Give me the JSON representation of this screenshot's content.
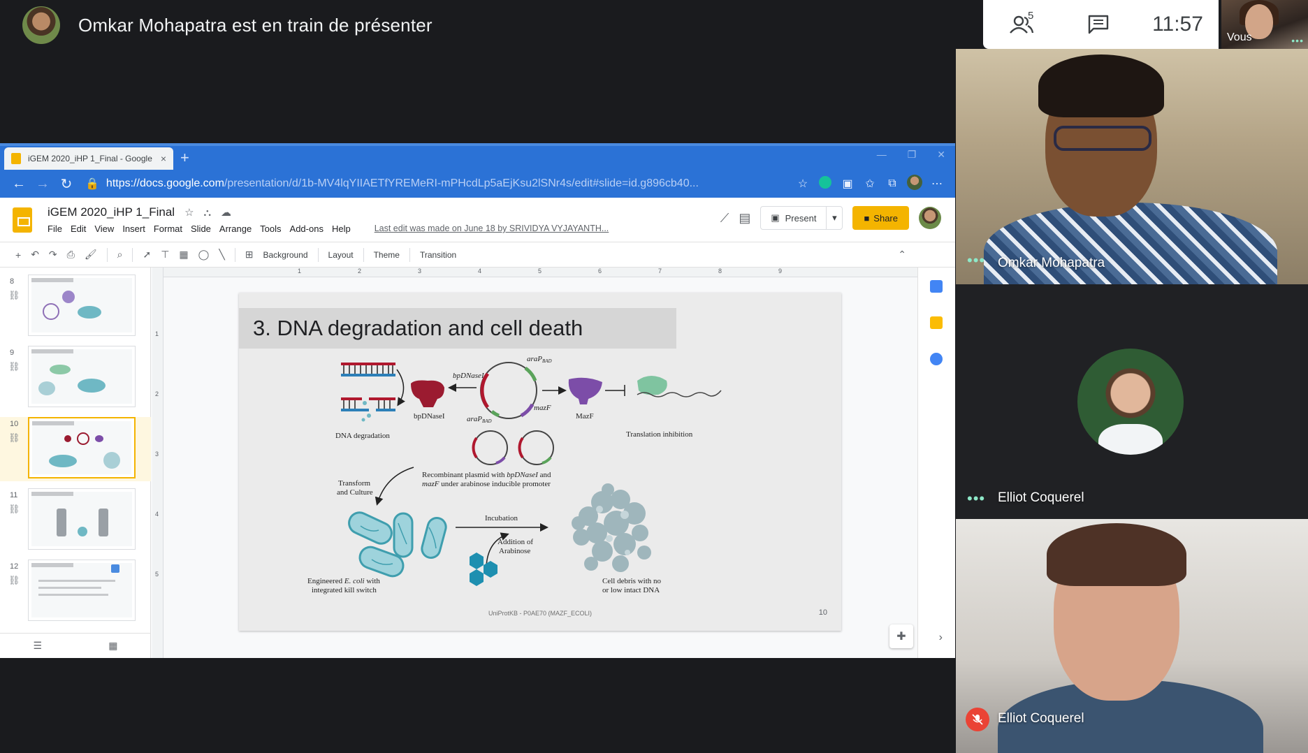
{
  "meeting": {
    "presenter_text": "Omkar Mohapatra est en train de présenter",
    "participant_count": "5",
    "clock": "11:57",
    "self_label": "Vous"
  },
  "browser": {
    "tab_title": "iGEM 2020_iHP 1_Final - Google",
    "tab_close": "×",
    "new_tab": "+",
    "url_host": "https://docs.google.com",
    "url_path": "/presentation/d/1b-MV4lqYIIAETfYREMeRI-mPHcdLp5aEjKsu2lSNr4s/edit#slide=id.g896cb40..."
  },
  "slides_app": {
    "doc_title": "iGEM 2020_iHP 1_Final",
    "menu": [
      "File",
      "Edit",
      "View",
      "Insert",
      "Format",
      "Slide",
      "Arrange",
      "Tools",
      "Add-ons",
      "Help"
    ],
    "last_edit": "Last edit was made on June 18 by SRIVIDYA VYJAYANTH...",
    "present_label": "Present",
    "share_label": "Share",
    "toolbar": {
      "background": "Background",
      "layout": "Layout",
      "theme": "Theme",
      "transition": "Transition"
    },
    "ruler_numbers": [
      "1",
      "2",
      "3",
      "4",
      "5",
      "6",
      "7",
      "8",
      "9"
    ],
    "vruler_numbers": [
      "1",
      "2",
      "3",
      "4",
      "5"
    ]
  },
  "filmstrip": [
    {
      "num": "8",
      "caption": "1. Antibiotic degradation"
    },
    {
      "num": "9",
      "caption": "2. Prevention of conjugation"
    },
    {
      "num": "10",
      "caption": "3. DNA degradation and cell death"
    },
    {
      "num": "11",
      "caption": "To Summarize..."
    },
    {
      "num": "12",
      "caption": "Acknowledgements"
    }
  ],
  "slide": {
    "title": "3. DNA degradation and cell death",
    "labels": {
      "dna_degradation": "DNA degradation",
      "bpdnasei_protein": "bpDNaseI",
      "bpdnasei_gene": "bpDNaseI",
      "arap_top": "araP",
      "arap_sub": "BAD",
      "arap_bottom": "araP",
      "mazf_gene": "mazF",
      "mazf_protein": "MazF",
      "translation_inhibition": "Translation inhibition",
      "recombinant_line1_a": "Recombinant plasmid with ",
      "recombinant_line1_b": "bpDNaseI",
      "recombinant_line1_c": " and",
      "recombinant_line2_a": "mazF",
      "recombinant_line2_b": " under arabinose inducible promoter",
      "transform_line1": "Transform",
      "transform_line2": "and Culture",
      "incubation": "Incubation",
      "addition_line1": "Addition of",
      "addition_line2": "Arabinose",
      "engineered_line1_a": "Engineered ",
      "engineered_line1_b": "E. coli",
      "engineered_line1_c": " with",
      "engineered_line2": "integrated kill switch",
      "debris_line1": "Cell debris with no",
      "debris_line2": "or low intact DNA"
    },
    "source": "UniProtKB - P0AE70 (MAZF_ECOLI)",
    "number": "10"
  },
  "participants": [
    {
      "name": "Omkar Mohapatra"
    },
    {
      "name": "Elliot Coquerel"
    },
    {
      "name": "Elliot Coquerel"
    }
  ],
  "colors": {
    "browser_blue": "#2b72d6",
    "slides_yellow": "#f4b400",
    "meet_dark": "#202124",
    "active_speaker_dots": "#8ee8c8",
    "muted_red": "#ea4335"
  }
}
